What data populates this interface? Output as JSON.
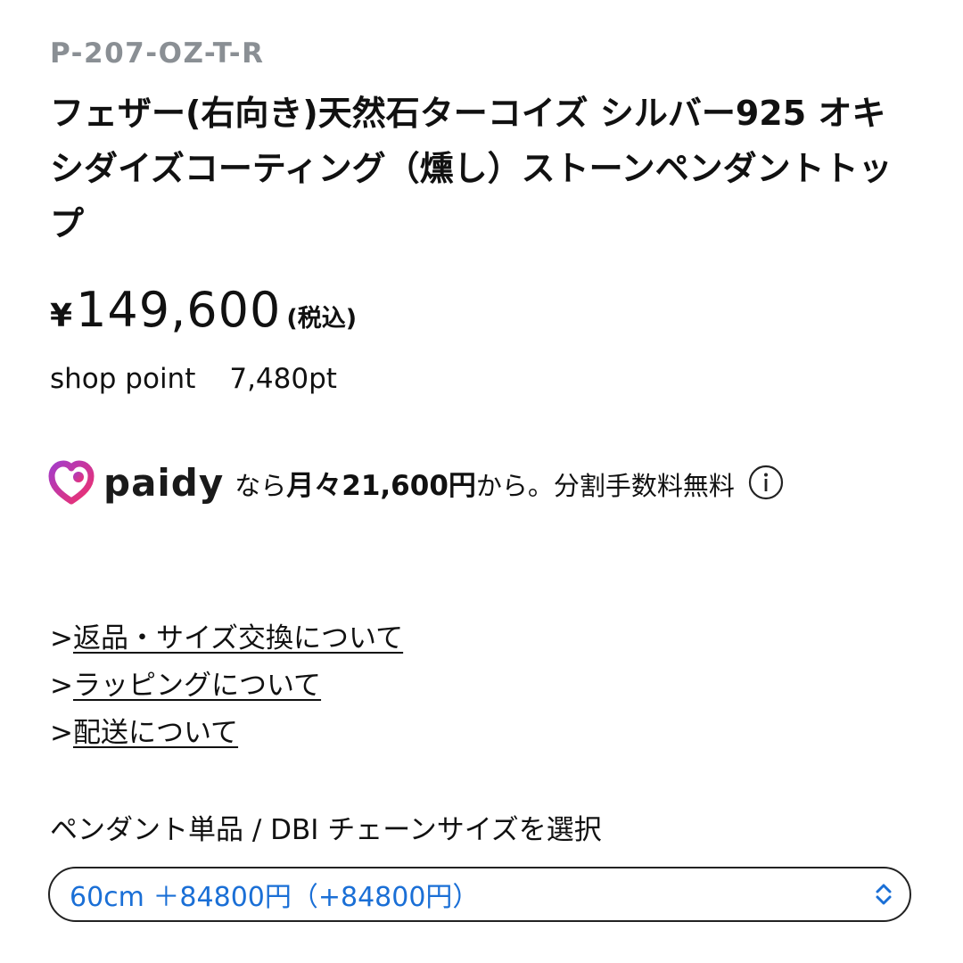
{
  "product": {
    "sku": "P-207-OZ-T-R",
    "title": "フェザー(右向き)天然石ターコイズ シルバー925 オキシダイズコーティング（燻し）ストーンペンダントトップ"
  },
  "price": {
    "currency_symbol": "¥",
    "amount": "149,600",
    "tax_note": "(税込)"
  },
  "points": {
    "label": "shop point",
    "value": "7,480pt"
  },
  "paidy": {
    "brand": "paidy",
    "text_prefix": "なら",
    "monthly": "月々21,600円",
    "text_suffix": "から。分割手数料無料",
    "brand_color": "#e5347a",
    "icons": [
      "paidy-heart-icon",
      "info-icon"
    ]
  },
  "links": [
    {
      "prefix": ">",
      "label": "返品・サイズ交換について"
    },
    {
      "prefix": ">",
      "label": "ラッピングについて"
    },
    {
      "prefix": ">",
      "label": "配送について"
    }
  ],
  "option_select": {
    "label": "ペンダント単品 / DBI チェーンサイズを選択",
    "selected_value": "60cm ＋84800円（+84800円）",
    "value_color": "#1a6fd6",
    "icon": "select-updown-chevron-icon"
  }
}
